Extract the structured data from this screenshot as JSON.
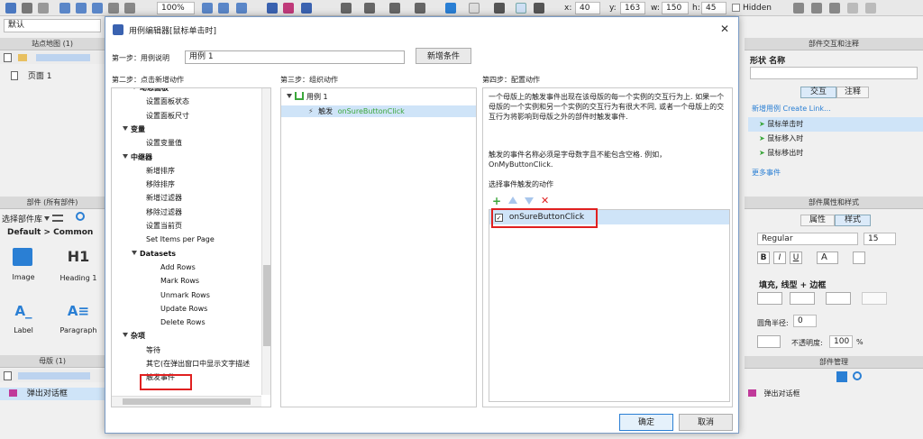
{
  "toolbar": {
    "zoom": "100%",
    "x_label": "x:",
    "x": "40",
    "y_label": "y:",
    "y": "163",
    "w_label": "w:",
    "w": "150",
    "h_label": "h:",
    "h": "45",
    "hidden": "Hidden"
  },
  "default_style": "默认",
  "left_panel": {
    "sitemap_title": "站点地图 (1)",
    "page1": "页面 1",
    "widgets_title": "部件 (所有部件)",
    "select_lib": "选择部件库",
    "breadcrumb": "Default > Common",
    "widgets": [
      {
        "label": "Image"
      },
      {
        "label": "Heading 1",
        "glyph": "H1"
      },
      {
        "label": "Label"
      },
      {
        "label": "Paragraph"
      }
    ],
    "masters_title": "母版 (1)",
    "master_item": "弹出对话框"
  },
  "right_panel": {
    "interactions_title": "部件交互和注释",
    "shape_name": "形状 名称",
    "tab_interaction": "交互",
    "tab_notes": "注释",
    "new_case": "新增用例",
    "create_link": "Create Link...",
    "events": [
      "鼠标单击时",
      "鼠标移入时",
      "鼠标移出时"
    ],
    "more_events": "更多事件",
    "props_title": "部件属性和样式",
    "tab_props": "属性",
    "tab_style": "样式",
    "font": "Regular",
    "font_size": "15",
    "fill_section": "填充, 线型 + 边框",
    "corner_label": "圆角半径:",
    "corner_value": "0",
    "opacity_label": "不透明度:",
    "opacity_value": "100",
    "opacity_unit": "%",
    "outline_title": "部件管理",
    "outline_item": "弹出对话框"
  },
  "dialog": {
    "title": "用例编辑器[鼠标单击时]",
    "step1_label": "第一步：用例说明",
    "case_name": "用例 1",
    "add_condition": "新增条件",
    "step2": "第二步：点击新增动作",
    "step3": "第三步：组织动作",
    "step4": "第四步：配置动作",
    "ok": "确定",
    "cancel": "取消",
    "actions": [
      {
        "t": "动态面板",
        "lvl": 1,
        "bold": true
      },
      {
        "t": "设置面板状态",
        "lvl": 2
      },
      {
        "t": "设置面板尺寸",
        "lvl": 2
      },
      {
        "t": "变量",
        "lvl": 0,
        "bold": true
      },
      {
        "t": "设置变量值",
        "lvl": 2
      },
      {
        "t": "中继器",
        "lvl": 0,
        "bold": true
      },
      {
        "t": "新增排序",
        "lvl": 2
      },
      {
        "t": "移除排序",
        "lvl": 2
      },
      {
        "t": "新增过滤器",
        "lvl": 2
      },
      {
        "t": "移除过滤器",
        "lvl": 2
      },
      {
        "t": "设置当前页",
        "lvl": 2
      },
      {
        "t": "Set Items per Page",
        "lvl": 2
      },
      {
        "t": "Datasets",
        "lvl": 1,
        "bold": true
      },
      {
        "t": "Add Rows",
        "lvl": 3
      },
      {
        "t": "Mark Rows",
        "lvl": 3
      },
      {
        "t": "Unmark Rows",
        "lvl": 3
      },
      {
        "t": "Update Rows",
        "lvl": 3
      },
      {
        "t": "Delete Rows",
        "lvl": 3
      },
      {
        "t": "杂项",
        "lvl": 0,
        "bold": true
      },
      {
        "t": "等待",
        "lvl": 2
      },
      {
        "t": "其它(在弹出窗口中显示文字描述",
        "lvl": 2
      },
      {
        "t": "触发事件",
        "lvl": 2
      }
    ],
    "organize": {
      "case": "用例 1",
      "action_prefix": "触发",
      "action_event": "onSureButtonClick"
    },
    "config": {
      "description": "一个母版上的触发事件出现在该母版的每一个实例的交互行为上. 如果一个母版的一个实例和另一个实例的交互行为有很大不同, 或者一个母版上的交互行为将影响到母版之外的部件时触发事件.",
      "naming": "触发的事件名称必须是字母数字且不能包含空格. 例如，OnMyButtonClick.",
      "select_label": "选择事件触发的动作",
      "event_item": "onSureButtonClick"
    }
  },
  "colors": {
    "accent": "#2a7fd4",
    "red": "#e02020",
    "green": "#3aa63a"
  }
}
